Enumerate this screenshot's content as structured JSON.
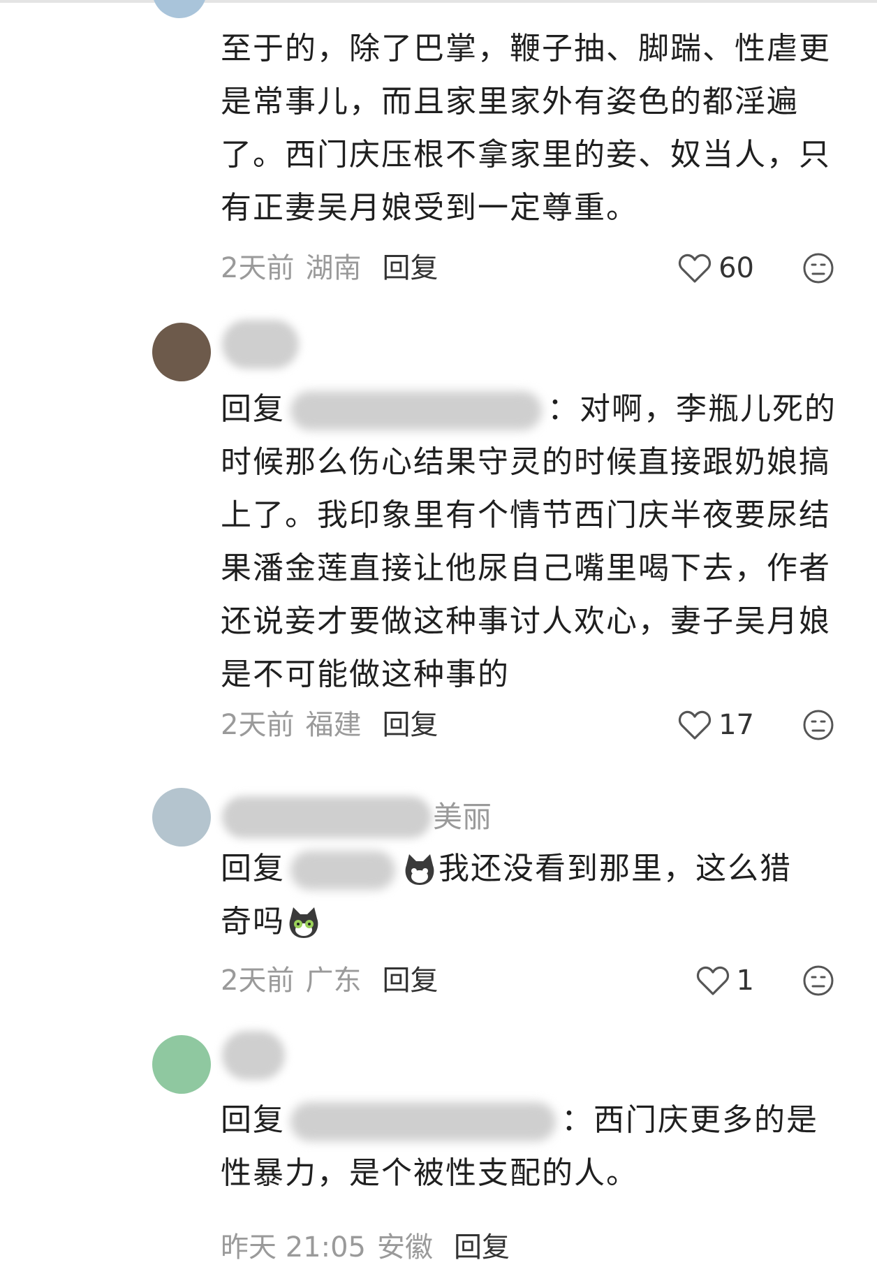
{
  "comments": [
    {
      "text": "至于的，除了巴掌，鞭子抽、脚踹、性虐更是常事儿，而且家里家外有姿色的都淫遍了。西门庆压根不拿家里的妾、奴当人，只有正妻吴月娘受到一定尊重。",
      "time": "2天前",
      "location": "湖南",
      "reply_label": "回复",
      "likes": "60"
    },
    {
      "reply_prefix": "回复",
      "mention_tail": "：",
      "text": "对啊，李瓶儿死的时候那么伤心结果守灵的时候直接跟奶娘搞上了。我印象里有个情节西门庆半夜要尿结果潘金莲直接让他尿自己嘴里喝下去，作者还说妾才要做这种事讨人欢心，妻子吴月娘是不可能做这种事的",
      "time": "2天前",
      "location": "福建",
      "reply_label": "回复",
      "likes": "17"
    },
    {
      "username_visible": "美丽",
      "reply_prefix": "回复",
      "text_a": "我还没看到那里，这么猎",
      "text_b": "奇吗",
      "emoji": "cat-emoji",
      "time": "2天前",
      "location": "广东",
      "reply_label": "回复",
      "likes": "1"
    },
    {
      "reply_prefix": "回复",
      "mention_tail": "：",
      "text": "西门庆更多的是性暴力，是个被性支配的人。",
      "time": "昨天 21:05",
      "location": "安徽",
      "reply_label": "回复"
    }
  ],
  "colors": {
    "text": "#1f1f1f",
    "meta": "#9a9a9a",
    "icon": "#555555"
  },
  "icons": [
    "heart-icon",
    "dislike-face-icon"
  ]
}
